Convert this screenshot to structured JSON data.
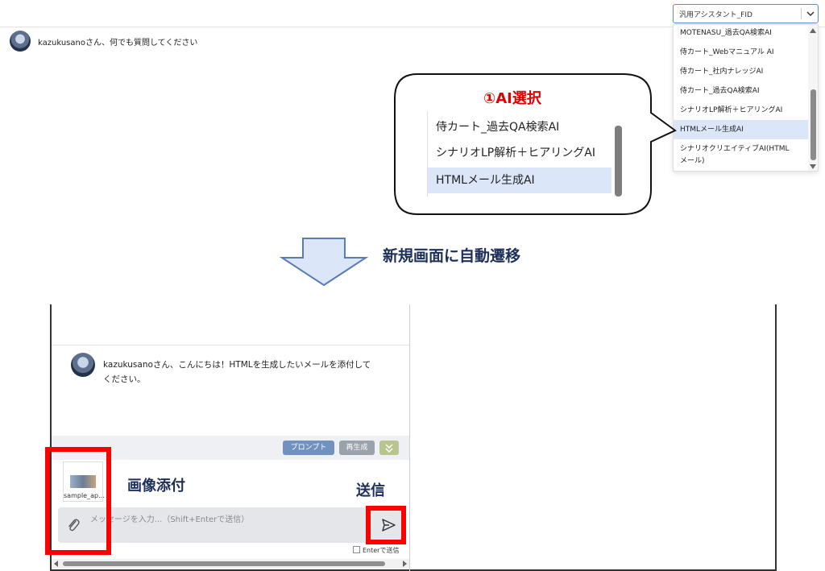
{
  "assistant_select": {
    "value": "汎用アシスタント_FID",
    "options": [
      "MOTENASU_過去QA検索AI",
      "侍カート_Webマニュアル AI",
      "侍カート_社内ナレッジAI",
      "侍カート_過去QA検索AI",
      "シナリオLP解析＋ヒアリングAI",
      "HTMLメール生成AI",
      "シナリオクリエイティブAI(HTML",
      "メール)"
    ],
    "selected_index": 5
  },
  "greeting_top": "kazukusanoさん、何でも質問してください",
  "callout": {
    "title": "①AI選択",
    "items": [
      "侍カート_過去QA検索AI",
      "シナリオLP解析＋ヒアリングAI",
      "HTMLメール生成AI"
    ],
    "selected_index": 2
  },
  "transition_label": "新規画面に自動遷移",
  "chat": {
    "message_line1": "kazukusanoさん、こんにちは！HTMLを生成したいメールを添付して",
    "message_line2": "ください。",
    "toolbar": {
      "prompt_label": "プロンプト",
      "regenerate_label": "再生成"
    },
    "attachment_name": "sample_ap...",
    "input_placeholder": "メッセージを入力...（Shift+Enterで送信）",
    "enter_send_label": "Enterで送信"
  },
  "annotations": {
    "attach_label": "画像添付",
    "send_label": "送信"
  },
  "colors": {
    "accent_red": "#ff0000",
    "navy_text": "#1c2f5a",
    "selected_row": "#dbe6f8",
    "prompt_pill": "#7191c0",
    "regen_pill": "#9aa2ac",
    "collapse_pill": "#b8c58e"
  }
}
